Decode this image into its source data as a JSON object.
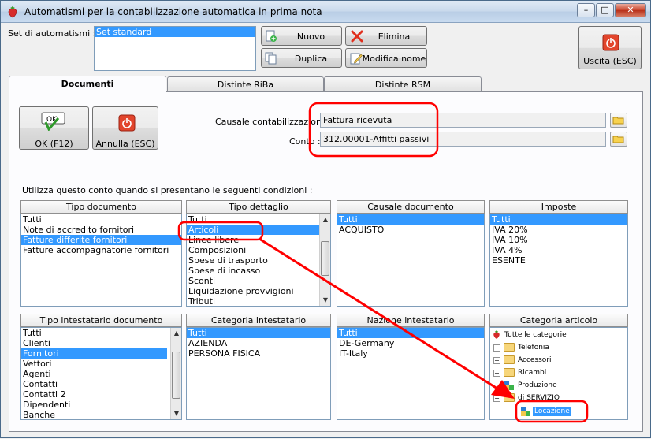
{
  "window": {
    "title": "Automatismi per la contabilizzazione automatica in prima nota"
  },
  "window_controls": {
    "minimize": "–",
    "maximize": "□",
    "close": "✕"
  },
  "set": {
    "label": "Set di automatismi :",
    "items": [
      "Set standard"
    ]
  },
  "toolbar": {
    "nuovo": "Nuovo",
    "elimina": "Elimina",
    "duplica": "Duplica",
    "modifica_nome": "Modifica nome",
    "uscita": "Uscita (ESC)"
  },
  "tabs": [
    "Documenti",
    "Distinte RiBa",
    "Distinte RSM"
  ],
  "form": {
    "ok_label": "OK (F12)",
    "ok_icon_text": "OK",
    "annulla_label": "Annulla (ESC)",
    "causale_label": "Causale contabilizzazione :",
    "causale_value": "Fattura ricevuta",
    "conto_label": "Conto :",
    "conto_value": "312.00001-Affitti passivi",
    "conditions_text": "Utilizza questo conto quando si presentano le seguenti condizioni :"
  },
  "panels": {
    "tipo_documento": {
      "header": "Tipo documento",
      "items": [
        "Tutti",
        "Note di accredito fornitori",
        "Fatture differite fornitori",
        "Fatture accompagnatorie fornitori"
      ],
      "selected": 2
    },
    "tipo_dettaglio": {
      "header": "Tipo dettaglio",
      "items": [
        "Tutti",
        "Articoli",
        "Linee libere",
        "Composizioni",
        "Spese di trasporto",
        "Spese di incasso",
        "Sconti",
        "Liquidazione provvigioni",
        "Tributi"
      ],
      "selected": 1
    },
    "causale_documento": {
      "header": "Causale documento",
      "items": [
        "Tutti",
        "ACQUISTO"
      ],
      "selected": 0
    },
    "imposte": {
      "header": "Imposte",
      "items": [
        "Tutti",
        "IVA 20%",
        "IVA 10%",
        "IVA 4%",
        "ESENTE"
      ],
      "selected": 0
    },
    "tipo_intestatario": {
      "header": "Tipo intestatario documento",
      "items": [
        "Tutti",
        "Clienti",
        "Fornitori",
        "Vettori",
        "Agenti",
        "Contatti",
        "Contatti 2",
        "Dipendenti",
        "Banche"
      ],
      "selected": 2
    },
    "categoria_intestatario": {
      "header": "Categoria intestatario",
      "items": [
        "Tutti",
        "AZIENDA",
        "PERSONA FISICA"
      ],
      "selected": 0
    },
    "nazione_intestatario": {
      "header": "Nazione intestatario",
      "items": [
        "Tutti",
        "DE-Germany",
        "IT-Italy"
      ],
      "selected": 0
    },
    "categoria_articolo": {
      "header": "Categoria articolo",
      "root": "Tutte le categorie",
      "children": [
        "Telefonia",
        "Accessori",
        "Ricambi",
        "Produzione",
        "di SERVIZIO"
      ],
      "grandchild": "Locazione"
    }
  },
  "colors": {
    "selection": "#3399ff",
    "annotation": "#ff0000"
  }
}
